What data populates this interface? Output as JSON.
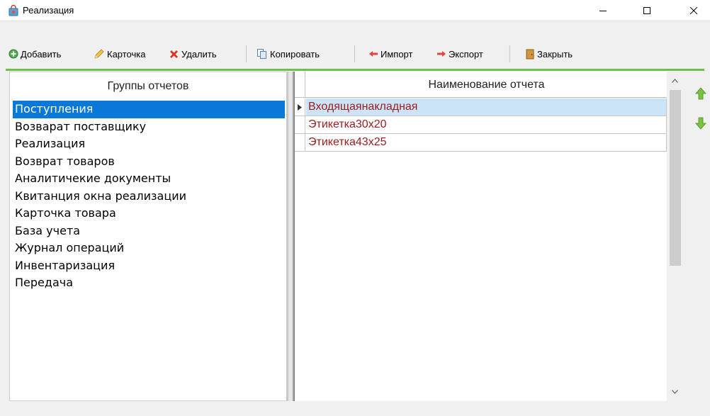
{
  "window": {
    "title": "Реализация",
    "icon": "shopping-bag-icon"
  },
  "toolbar": {
    "add_label": "Добавить",
    "card_label": "Карточка",
    "delete_label": "Удалить",
    "copy_label": "Копировать",
    "import_label": "Импорт",
    "export_label": "Экспорт",
    "close_label": "Закрыть"
  },
  "left_panel": {
    "header": "Группы отчетов",
    "groups": [
      "Поступления",
      "Возварат поставщику",
      "Реализация",
      "Возврат товаров",
      "Аналитичекие документы",
      "Квитанция окна реализации",
      "Карточка товара",
      "База учета",
      "Журнал операций",
      "Инвентаризация",
      "Передача"
    ],
    "selected_index": 0
  },
  "grid": {
    "column_header": "Наименование отчета",
    "rows": [
      "Входящаянакладная",
      "Этикетка30х20",
      "Этикетка43х25"
    ],
    "selected_index": 0
  },
  "colors": {
    "accent_green": "#6fbf4a",
    "selection_blue": "#0a78d7",
    "row_selection": "#cce4f7",
    "report_text": "#9b1c1c"
  }
}
